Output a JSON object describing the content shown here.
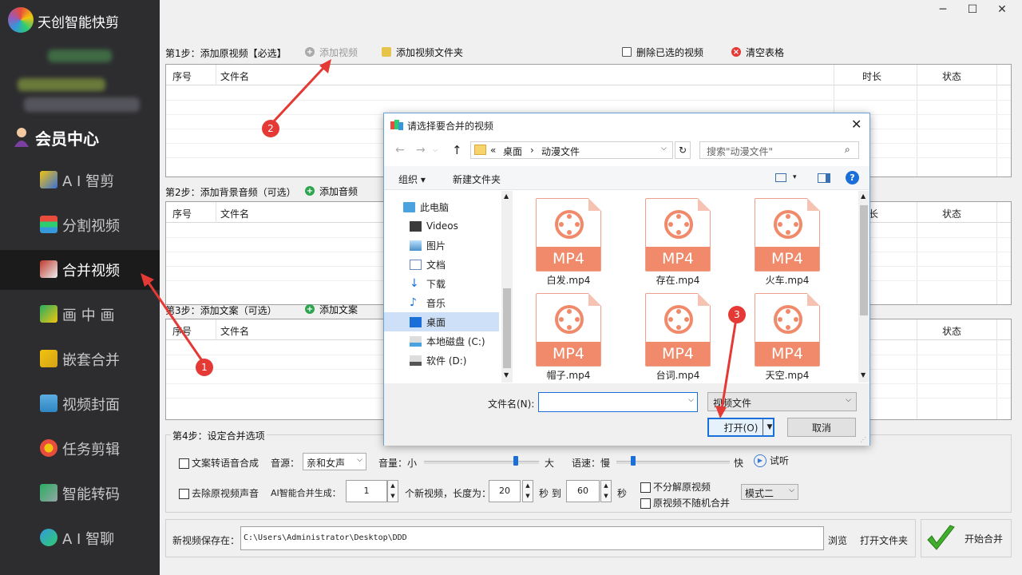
{
  "app": {
    "title": "天创智能快剪"
  },
  "sidebar": {
    "member": "会员中心",
    "items": [
      {
        "label": "A I 智剪"
      },
      {
        "label": "分割视频"
      },
      {
        "label": "合并视频"
      },
      {
        "label": "画 中 画"
      },
      {
        "label": "嵌套合并"
      },
      {
        "label": "视频封面"
      },
      {
        "label": "任务剪辑"
      },
      {
        "label": "智能转码"
      },
      {
        "label": "A I 智聊"
      }
    ]
  },
  "window": {
    "minimize": "─",
    "maximize": "☐",
    "close": "✕"
  },
  "step1": {
    "label": "第1步：添加原视频【必选】",
    "add_video": "添加视频",
    "add_folder": "添加视频文件夹",
    "delete_selected": "删除已选的视频",
    "clear_table": "清空表格",
    "columns": {
      "index": "序号",
      "filename": "文件名",
      "duration": "时长",
      "status": "状态"
    }
  },
  "step2": {
    "label": "第2步：添加背景音频（可选）",
    "add_audio": "添加音频",
    "columns": {
      "index": "序号",
      "filename": "文件名",
      "duration": "长",
      "status": "状态"
    }
  },
  "step3": {
    "label": "第3步：添加文案（可选）",
    "add_text": "添加文案",
    "columns": {
      "index": "序号",
      "filename": "文件名",
      "status": "状态"
    }
  },
  "step4": {
    "label": "第4步：设定合并选项",
    "tts": "文案转语音合成",
    "voice_label": "音源：",
    "voice_value": "亲和女声",
    "volume_label": "音量：小",
    "volume_max": "大",
    "volume_level": 0.8,
    "speed_label": "语速：慢",
    "speed_max": "快",
    "speed_level": 0.15,
    "preview": "试听",
    "remove_audio": "去除原视频声音",
    "ai_gen_label": "AI智能合并生成：",
    "ai_count": "1",
    "length_label": "个新视频，长度为：",
    "min_len": "20",
    "sec_to": "秒 到",
    "max_len": "60",
    "sec": "秒",
    "no_split": "不分解原视频",
    "no_random": "原视频不随机合并",
    "mode": "模式二"
  },
  "save": {
    "label": "新视频保存在：",
    "path": "C:\\Users\\Administrator\\Desktop\\DDD",
    "browse": "浏览",
    "open_folder": "打开文件夹",
    "start": "开始合并"
  },
  "dialog": {
    "title": "请选择要合并的视频",
    "breadcrumb": [
      "«",
      "桌面",
      "›",
      "动漫文件"
    ],
    "search_placeholder": "搜索\"动漫文件\"",
    "organize": "组织 ▾",
    "new_folder": "新建文件夹",
    "tree": [
      {
        "label": "此电脑",
        "icon": "computer-icon"
      },
      {
        "label": "Videos",
        "icon": "videos-icon"
      },
      {
        "label": "图片",
        "icon": "pictures-icon"
      },
      {
        "label": "文档",
        "icon": "documents-icon"
      },
      {
        "label": "下载",
        "icon": "download-icon"
      },
      {
        "label": "音乐",
        "icon": "music-icon"
      },
      {
        "label": "桌面",
        "icon": "desktop-icon"
      },
      {
        "label": "本地磁盘 (C:)",
        "icon": "drive-icon"
      },
      {
        "label": "软件 (D:)",
        "icon": "drive-icon"
      }
    ],
    "files": [
      {
        "name": "白发.mp4",
        "badge": "MP4"
      },
      {
        "name": "存在.mp4",
        "badge": "MP4"
      },
      {
        "name": "火车.mp4",
        "badge": "MP4"
      },
      {
        "name": "帽子.mp4",
        "badge": "MP4"
      },
      {
        "name": "台词.mp4",
        "badge": "MP4"
      },
      {
        "name": "天空.mp4",
        "badge": "MP4"
      }
    ],
    "filename_label": "文件名(N):",
    "filetype": "视频文件",
    "open": "打开(O)",
    "cancel": "取消"
  },
  "annotations": [
    "1",
    "2",
    "3"
  ]
}
